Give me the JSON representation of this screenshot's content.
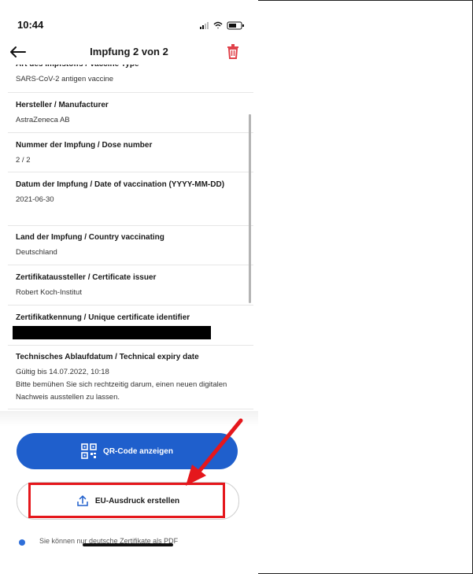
{
  "status_bar": {
    "time": "10:44"
  },
  "header": {
    "title": "Impfung 2 von 2"
  },
  "fields": [
    {
      "label": "Art des Impfstoffs / Vaccine Type",
      "value": "SARS-CoV-2 antigen vaccine"
    },
    {
      "label": "Hersteller / Manufacturer",
      "value": "AstraZeneca AB"
    },
    {
      "label": "Nummer der Impfung / Dose number",
      "value": "2 / 2"
    },
    {
      "label": "Datum der Impfung / Date of vaccination (YYYY-MM-DD)",
      "value": "2021-06-30"
    },
    {
      "label": "Land der Impfung / Country vaccinating",
      "value": "Deutschland"
    },
    {
      "label": "Zertifikataussteller / Certificate issuer",
      "value": "Robert Koch-Institut"
    },
    {
      "label": "Zertifikatkennung / Unique certificate identifier",
      "value": ""
    },
    {
      "label": "Technisches Ablaufdatum / Technical expiry date",
      "value": "Gültig bis 14.07.2022, 10:18",
      "note": "Bitte bemühen Sie sich rechtzeitig darum, einen neuen digitalen Nachweis ausstellen zu lassen."
    }
  ],
  "buttons": {
    "qr_code": "QR-Code anzeigen",
    "eu_print": "EU-Ausdruck erstellen"
  },
  "info": {
    "text": "Sie können nur deutsche Zertifikate als PDF"
  },
  "colors": {
    "primary": "#1f5fcc",
    "annotation": "#e5171c",
    "delete": "#e0424b"
  }
}
